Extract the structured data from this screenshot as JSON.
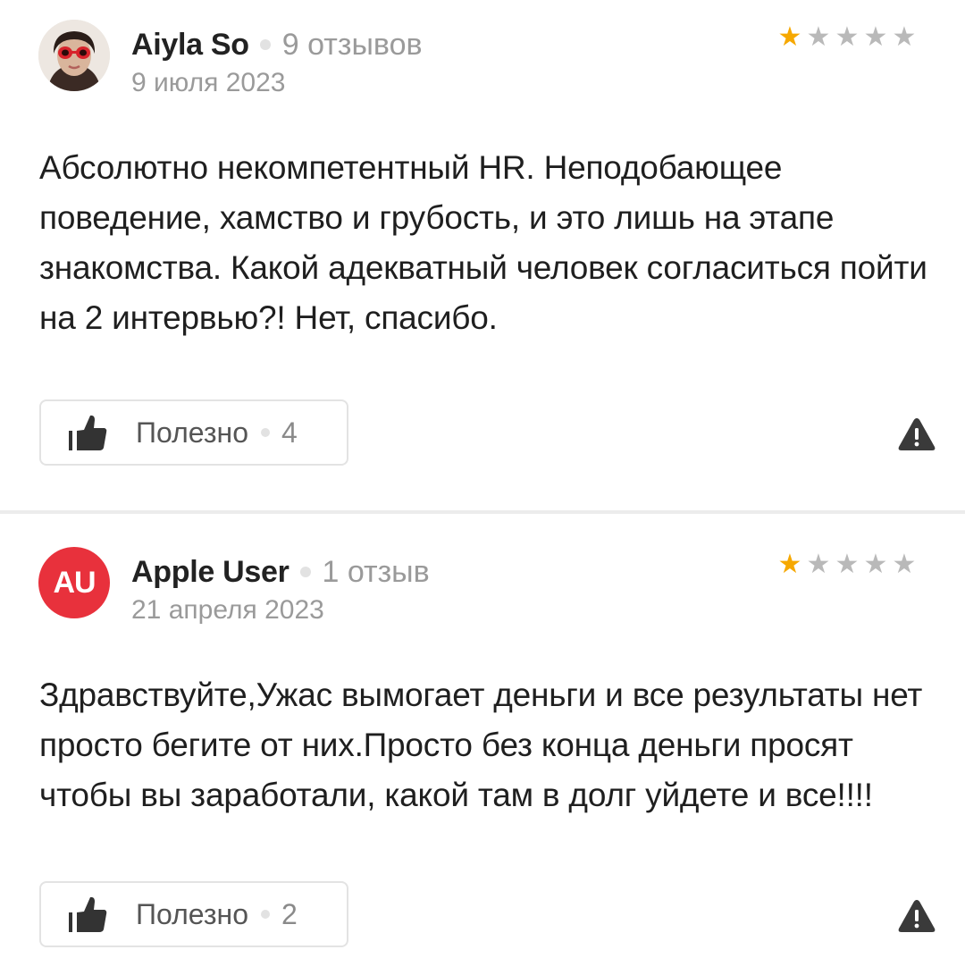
{
  "reviews": [
    {
      "author": "Aiyla So",
      "review_count": "9 отзывов",
      "date": "9 июля 2023",
      "rating": 1,
      "text": "Абсолютно некомпетентный HR. Неподобающее поведение, хамство и грубость, и это лишь на этапе знакомства. Какой адекватный человек согласиться пойти на 2 интервью?! Нет, спасибо.",
      "helpful_label": "Полезно",
      "helpful_count": "4"
    },
    {
      "author": "Apple User",
      "avatar_initials": "AU",
      "review_count": "1 отзыв",
      "date": "21 апреля 2023",
      "rating": 1,
      "text": "Здравствуйте,Ужас вымогает деньги и все результаты нет просто бегите от них.Просто без конца деньги просят чтобы вы заработали, какой там в долг уйдете и все!!!!",
      "helpful_label": "Полезно",
      "helpful_count": "2"
    }
  ],
  "colors": {
    "star_filled": "#f6a800",
    "star_empty": "#b9b9b9",
    "avatar_initials_bg": "#e8313c",
    "muted_text": "#9a9a9a"
  },
  "icons": {
    "thumb": "thumbs-up-icon",
    "report": "warning-triangle-icon",
    "star": "star-icon"
  }
}
